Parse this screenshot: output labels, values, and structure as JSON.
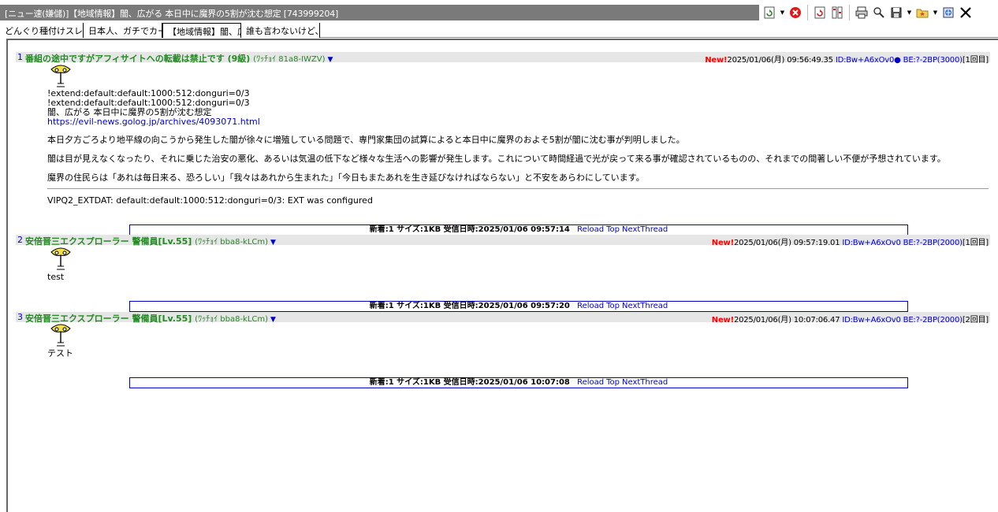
{
  "window": {
    "title": "[ニュー速(嫌儲)]【地域情報】闇、広がる  本日中に魔界の5割が沈む想定 [743999204]"
  },
  "toolbar": {
    "icons": [
      "refresh-icon",
      "stop-icon",
      "reload-thread-icon",
      "split-icon",
      "print-icon",
      "search-icon",
      "save-icon",
      "favorite-folder-icon",
      "browser-icon",
      "close-icon"
    ]
  },
  "tabs": [
    {
      "label": "どんぐり種付けスレ"
    },
    {
      "label": "日本人、ガチでカー"
    },
    {
      "label": "【地域情報】闇、広が"
    },
    {
      "label": "誰も言わないけど、"
    }
  ],
  "posts": [
    {
      "num": "1",
      "name": "番組の途中ですがアフィサイトへの転載は禁止です (9級)",
      "trip": "(ﾜｯﾁｮｲ 81a8-IWZV)",
      "new_label": "New!",
      "date": "2025/01/06(月) 09:56:49.35",
      "id": "ID:Bw+A6xOv0●",
      "be": "BE:?-2BP(3000)",
      "count": "[1回目]",
      "lines": [
        "!extend:default:default:1000:512:donguri=0/3",
        "!extend:default:default:1000:512:donguri=0/3",
        "闇、広がる  本日中に魔界の5割が沈む想定"
      ],
      "link": "https://evil-news.golog.jp/archives/4093071.html",
      "paragraphs": [
        "本日夕方ごろより地平線の向こうから発生した闇が徐々に増殖している問題で、専門家集団の試算によると本日中に魔界のおよそ5割が闇に沈む事が判明しました。",
        "闇は目が見えなくなったり、それに乗じた治安の悪化、あるいは気温の低下など様々な生活への影響が発生します。これについて時間経過で光が戻って来る事が確認されているものの、それまでの間著しい不便が予想されています。",
        "魔界の住民らは「あれは毎日来る、恐ろしい」「我々はあれから生まれた」「今日もまたあれを生き延びなければならない」と不安をあらわにしています。"
      ],
      "ext": "VIPQ2_EXTDAT: default:default:1000:512:donguri=0/3: EXT was configured"
    },
    {
      "num": "2",
      "name": "安倍晋三エクスプローラー 警備員[Lv.55]",
      "trip": "(ﾜｯﾁｮｲ bba8-kLCm)",
      "new_label": "New!",
      "date": "2025/01/06(月) 09:57:19.01",
      "id": "ID:Bw+A6xOv0",
      "be": "BE:?-2BP(2000)",
      "count": "[1回目]",
      "text": "test"
    },
    {
      "num": "3",
      "name": "安倍晋三エクスプローラー 警備員[Lv.55]",
      "trip": "(ﾜｯﾁｮｲ bba8-kLCm)",
      "new_label": "New!",
      "date": "2025/01/06(月) 10:07:06.47",
      "id": "ID:Bw+A6xOv0",
      "be": "BE:?-2BP(2000)",
      "count": "[2回目]",
      "text": "テスト"
    }
  ],
  "infobars": [
    {
      "stats": "新着:1  サイズ:1KB  受信日時:2025/01/06 09:57:14",
      "reload": "Reload",
      "top": "Top",
      "next": "NextThread"
    },
    {
      "stats": "新着:1  サイズ:1KB  受信日時:2025/01/06 09:57:20",
      "reload": "Reload",
      "top": "Top",
      "next": "NextThread"
    },
    {
      "stats": "新着:1  サイズ:1KB  受信日時:2025/01/06 10:07:08",
      "reload": "Reload",
      "top": "Top",
      "next": "NextThread"
    }
  ],
  "colors": {
    "name": "#228b22",
    "link": "#0000cc",
    "new": "#ff0000",
    "titlebar": "#7a7a7a"
  }
}
